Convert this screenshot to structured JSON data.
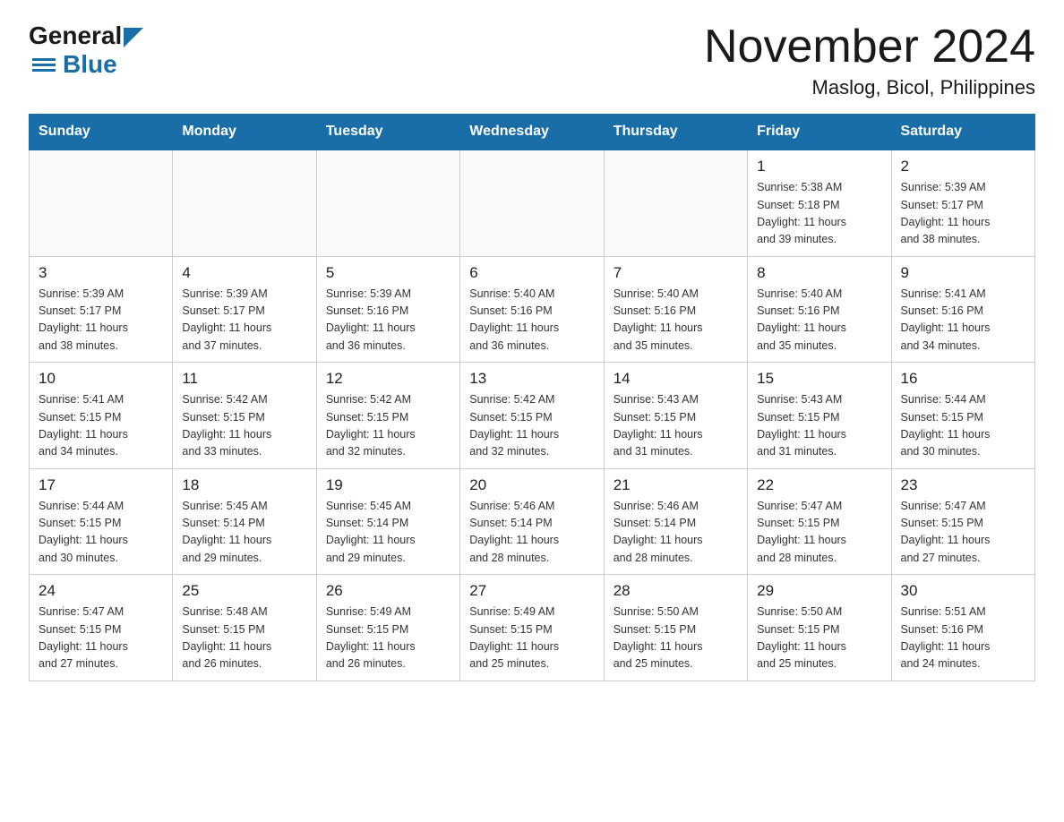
{
  "logo": {
    "general": "General",
    "blue": "Blue"
  },
  "title": "November 2024",
  "subtitle": "Maslog, Bicol, Philippines",
  "days_of_week": [
    "Sunday",
    "Monday",
    "Tuesday",
    "Wednesday",
    "Thursday",
    "Friday",
    "Saturday"
  ],
  "weeks": [
    [
      {
        "day": "",
        "info": ""
      },
      {
        "day": "",
        "info": ""
      },
      {
        "day": "",
        "info": ""
      },
      {
        "day": "",
        "info": ""
      },
      {
        "day": "",
        "info": ""
      },
      {
        "day": "1",
        "info": "Sunrise: 5:38 AM\nSunset: 5:18 PM\nDaylight: 11 hours\nand 39 minutes."
      },
      {
        "day": "2",
        "info": "Sunrise: 5:39 AM\nSunset: 5:17 PM\nDaylight: 11 hours\nand 38 minutes."
      }
    ],
    [
      {
        "day": "3",
        "info": "Sunrise: 5:39 AM\nSunset: 5:17 PM\nDaylight: 11 hours\nand 38 minutes."
      },
      {
        "day": "4",
        "info": "Sunrise: 5:39 AM\nSunset: 5:17 PM\nDaylight: 11 hours\nand 37 minutes."
      },
      {
        "day": "5",
        "info": "Sunrise: 5:39 AM\nSunset: 5:16 PM\nDaylight: 11 hours\nand 36 minutes."
      },
      {
        "day": "6",
        "info": "Sunrise: 5:40 AM\nSunset: 5:16 PM\nDaylight: 11 hours\nand 36 minutes."
      },
      {
        "day": "7",
        "info": "Sunrise: 5:40 AM\nSunset: 5:16 PM\nDaylight: 11 hours\nand 35 minutes."
      },
      {
        "day": "8",
        "info": "Sunrise: 5:40 AM\nSunset: 5:16 PM\nDaylight: 11 hours\nand 35 minutes."
      },
      {
        "day": "9",
        "info": "Sunrise: 5:41 AM\nSunset: 5:16 PM\nDaylight: 11 hours\nand 34 minutes."
      }
    ],
    [
      {
        "day": "10",
        "info": "Sunrise: 5:41 AM\nSunset: 5:15 PM\nDaylight: 11 hours\nand 34 minutes."
      },
      {
        "day": "11",
        "info": "Sunrise: 5:42 AM\nSunset: 5:15 PM\nDaylight: 11 hours\nand 33 minutes."
      },
      {
        "day": "12",
        "info": "Sunrise: 5:42 AM\nSunset: 5:15 PM\nDaylight: 11 hours\nand 32 minutes."
      },
      {
        "day": "13",
        "info": "Sunrise: 5:42 AM\nSunset: 5:15 PM\nDaylight: 11 hours\nand 32 minutes."
      },
      {
        "day": "14",
        "info": "Sunrise: 5:43 AM\nSunset: 5:15 PM\nDaylight: 11 hours\nand 31 minutes."
      },
      {
        "day": "15",
        "info": "Sunrise: 5:43 AM\nSunset: 5:15 PM\nDaylight: 11 hours\nand 31 minutes."
      },
      {
        "day": "16",
        "info": "Sunrise: 5:44 AM\nSunset: 5:15 PM\nDaylight: 11 hours\nand 30 minutes."
      }
    ],
    [
      {
        "day": "17",
        "info": "Sunrise: 5:44 AM\nSunset: 5:15 PM\nDaylight: 11 hours\nand 30 minutes."
      },
      {
        "day": "18",
        "info": "Sunrise: 5:45 AM\nSunset: 5:14 PM\nDaylight: 11 hours\nand 29 minutes."
      },
      {
        "day": "19",
        "info": "Sunrise: 5:45 AM\nSunset: 5:14 PM\nDaylight: 11 hours\nand 29 minutes."
      },
      {
        "day": "20",
        "info": "Sunrise: 5:46 AM\nSunset: 5:14 PM\nDaylight: 11 hours\nand 28 minutes."
      },
      {
        "day": "21",
        "info": "Sunrise: 5:46 AM\nSunset: 5:14 PM\nDaylight: 11 hours\nand 28 minutes."
      },
      {
        "day": "22",
        "info": "Sunrise: 5:47 AM\nSunset: 5:15 PM\nDaylight: 11 hours\nand 28 minutes."
      },
      {
        "day": "23",
        "info": "Sunrise: 5:47 AM\nSunset: 5:15 PM\nDaylight: 11 hours\nand 27 minutes."
      }
    ],
    [
      {
        "day": "24",
        "info": "Sunrise: 5:47 AM\nSunset: 5:15 PM\nDaylight: 11 hours\nand 27 minutes."
      },
      {
        "day": "25",
        "info": "Sunrise: 5:48 AM\nSunset: 5:15 PM\nDaylight: 11 hours\nand 26 minutes."
      },
      {
        "day": "26",
        "info": "Sunrise: 5:49 AM\nSunset: 5:15 PM\nDaylight: 11 hours\nand 26 minutes."
      },
      {
        "day": "27",
        "info": "Sunrise: 5:49 AM\nSunset: 5:15 PM\nDaylight: 11 hours\nand 25 minutes."
      },
      {
        "day": "28",
        "info": "Sunrise: 5:50 AM\nSunset: 5:15 PM\nDaylight: 11 hours\nand 25 minutes."
      },
      {
        "day": "29",
        "info": "Sunrise: 5:50 AM\nSunset: 5:15 PM\nDaylight: 11 hours\nand 25 minutes."
      },
      {
        "day": "30",
        "info": "Sunrise: 5:51 AM\nSunset: 5:16 PM\nDaylight: 11 hours\nand 24 minutes."
      }
    ]
  ]
}
